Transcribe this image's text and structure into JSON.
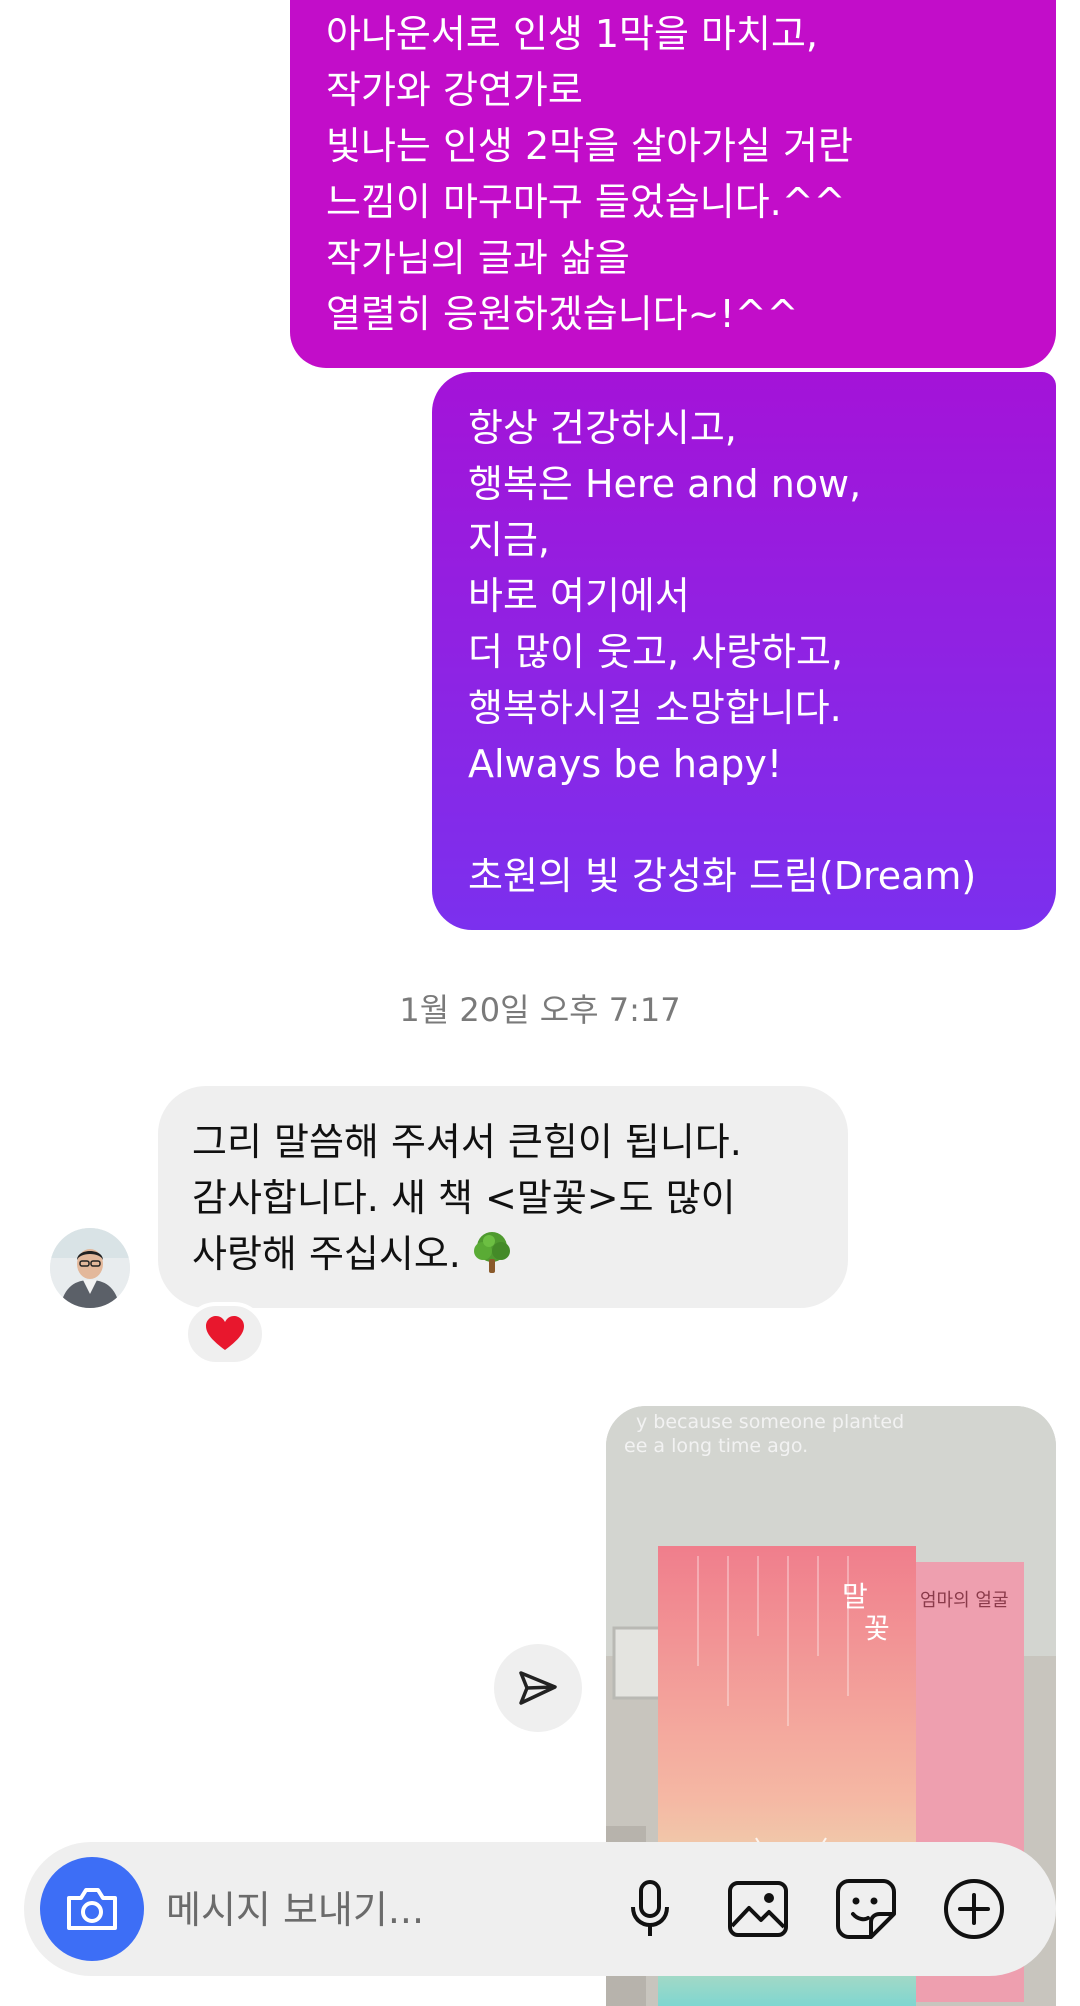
{
  "thread": {
    "outgoing_1": "아나운서로 인생 1막을 마치고,\n작가와 강연가로\n빛나는 인생 2막을 살아가실 거란\n느낌이 마구마구 들었습니다.^^\n작가님의 글과 삶을\n열렬히 응원하겠습니다~!^^",
    "outgoing_2": "항상 건강하시고,\n행복은 Here and now,\n지금,\n바로 여기에서\n더 많이 웃고, 사랑하고,\n행복하시길 소망합니다.\nAlways be hapy!\n\n초원의 빛 강성화 드림(Dream)",
    "timestamp": "1월 20일 오후 7:17",
    "incoming_1": "그리 말씀해 주셔서 큰힘이 됩니다.\n감사합니다. 새 책 <말꽃>도 많이\n사랑해 주십시오.",
    "reaction": "heart"
  },
  "photo": {
    "wall_text_1": "y because someone planted",
    "wall_text_2": "ee a long time ago.",
    "book_title_1": "말",
    "book_title_2": "꽃",
    "book_subtitle": "엄마의 얼굴"
  },
  "composer": {
    "placeholder": "메시지 보내기...",
    "icons": [
      "camera-icon",
      "microphone-icon",
      "gallery-icon",
      "sticker-icon",
      "plus-icon"
    ]
  },
  "colors": {
    "bubble_1": "#c20dc9",
    "bubble_2_top": "#a413d8",
    "bubble_2_bottom": "#7b30ee",
    "camera_button": "#3d6ef6",
    "incoming_bubble": "#efefef"
  }
}
